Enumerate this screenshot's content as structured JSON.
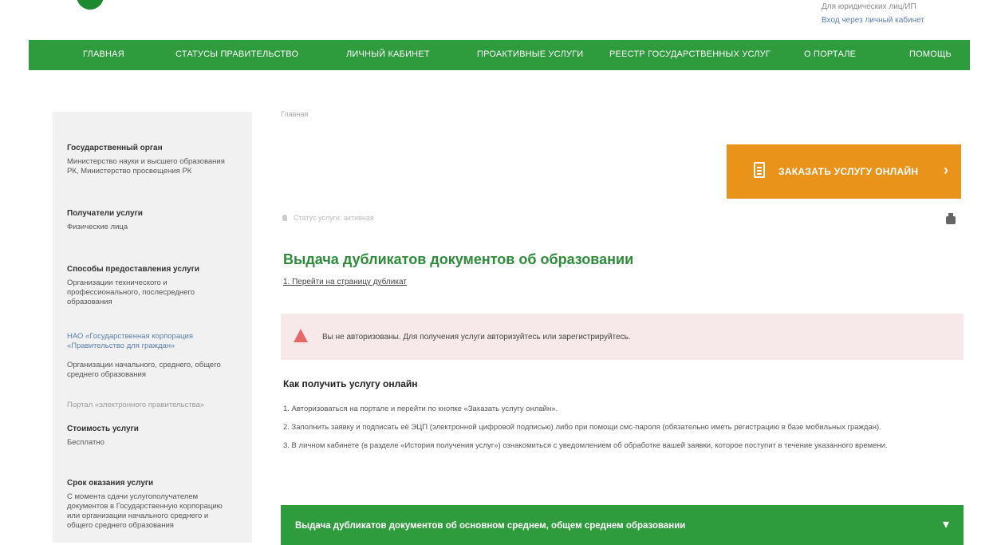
{
  "header": {
    "login_line1": "Для юридических лиц/ИП",
    "login_line2": "Вход через личный кабинет"
  },
  "nav": {
    "items": [
      "ГЛАВНАЯ",
      "СТАТУСЫ ПРАВИТЕЛЬСТВО",
      "ЛИЧНЫЙ КАБИНЕТ",
      "ПРОАКТИВНЫЕ УСЛУГИ",
      "РЕЕСТР ГОСУДАРСТВЕННЫХ УСЛУГ",
      "О ПОРТАЛЕ",
      "ПОМОЩЬ"
    ]
  },
  "sidebar": {
    "blocks": [
      {
        "heading": "Государственный орган",
        "text": "Министерство науки и высшего образования РК, Министерство просвещения РК"
      },
      {
        "heading": "Получатели услуги",
        "text": "Физические лица"
      },
      {
        "heading": "Способы предоставления услуги",
        "text": "Организации технического и профессионального, послесреднего образования"
      },
      {
        "heading": "",
        "text": "НАО «Государственная корпорация «Правительство для граждан»",
        "style": "link"
      },
      {
        "heading": "",
        "text": "Организации начального, среднего, общего среднего образования"
      },
      {
        "heading": "",
        "text": "Портал «электронного правительства»",
        "style": "muted"
      },
      {
        "heading": "Стоимость услуги",
        "text": "Бесплатно"
      },
      {
        "heading": "Срок оказания услуги",
        "text": "С момента сдачи услугополучателем документов в Государственную корпорацию или организации начального среднего и общего среднего образования"
      }
    ]
  },
  "main": {
    "crumb_small": "Главная",
    "order_button": "ЗАКАЗАТЬ УСЛУГУ ОНЛАЙН",
    "small_breadcrumb": "Статус услуги: активная",
    "title": "Выдача дубликатов документов об образовании",
    "sub_link": "1. Перейти на страницу дубликат",
    "alert_text": "Вы не авторизованы. Для получения услуги авторизуйтесь или зарегистрируйтесь.",
    "how_title": "Как получить услугу онлайн",
    "steps": [
      "1. Авторизоваться на портале и перейти по кнопке «Заказать услугу онлайн».",
      "2. Заполнить заявку и подписать её ЭЦП (электронной цифровой подписью) либо при помощи смс-пароля (обязательно иметь регистрацию в базе мобильных граждан).",
      "3. В личном кабинете (в разделе «История получения услуг») ознакомиться с уведомлением об обработке вашей заявки, которое поступит в течение указанного времени."
    ],
    "accordion_label": "Выдача дубликатов документов об основном среднем, общем среднем образовании"
  }
}
